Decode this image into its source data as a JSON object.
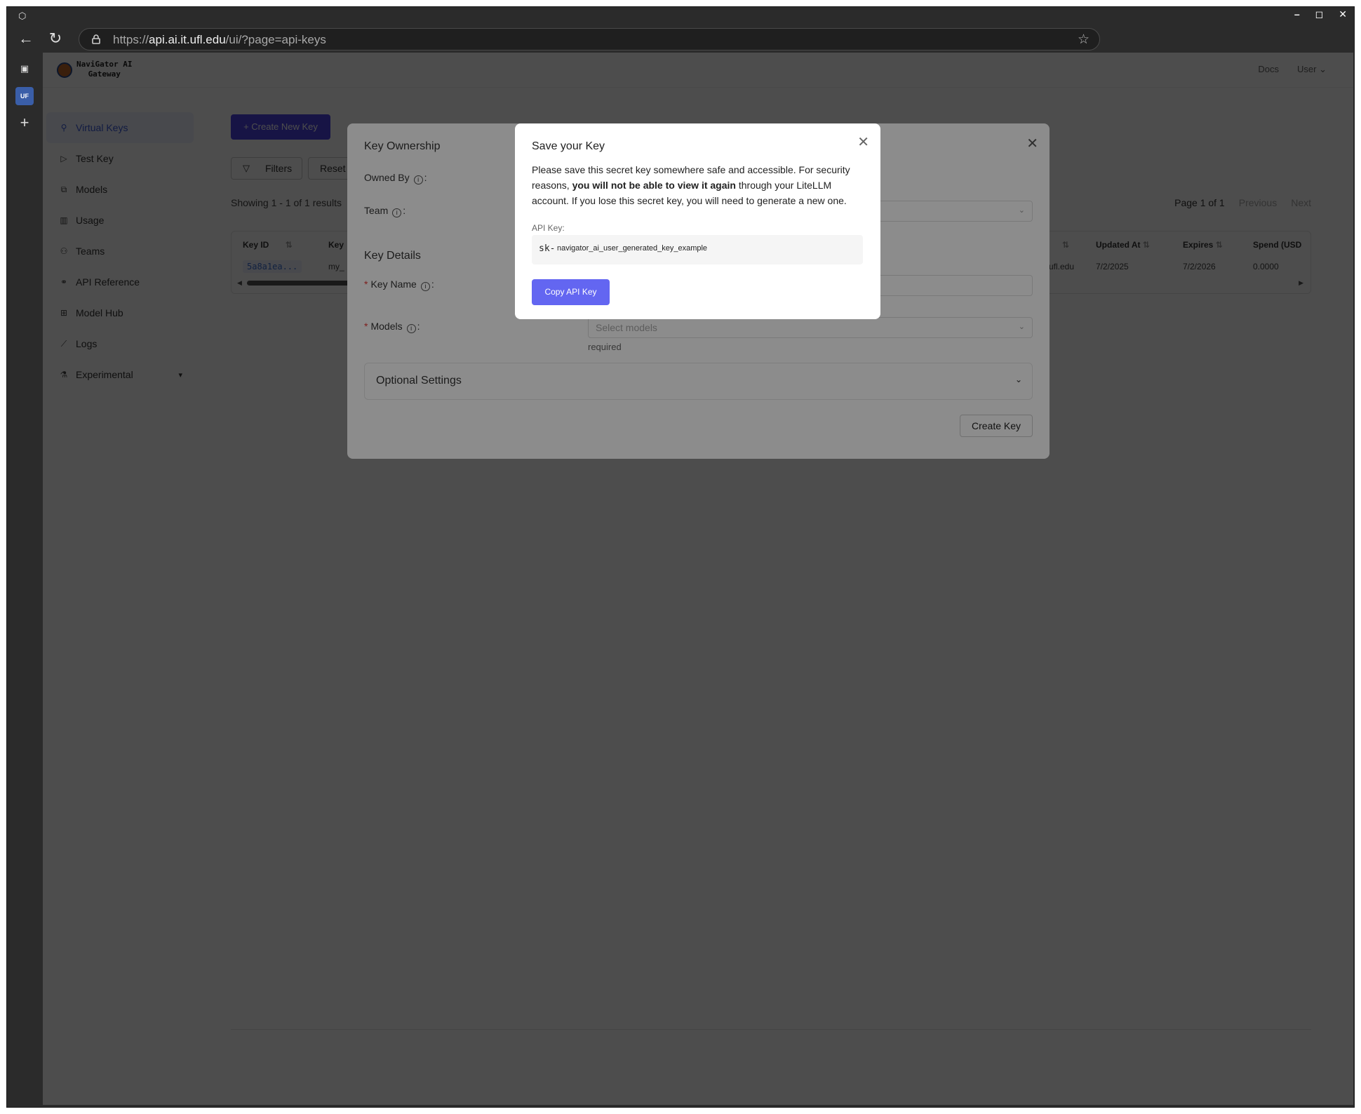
{
  "browser": {
    "url_scheme": "https://",
    "url_host": "api.ai.it.ufl.edu",
    "url_path": "/ui/?page=api-keys",
    "tab_favicon_text": "UF"
  },
  "app": {
    "brand_line1": "NaviGator AI",
    "brand_line2": "Gateway",
    "top_docs": "Docs",
    "top_user": "User"
  },
  "sidebar": {
    "items": [
      {
        "label": "Virtual Keys",
        "icon": "key-icon"
      },
      {
        "label": "Test Key",
        "icon": "play-circle-icon"
      },
      {
        "label": "Models",
        "icon": "blocks-icon"
      },
      {
        "label": "Usage",
        "icon": "bar-chart-icon"
      },
      {
        "label": "Teams",
        "icon": "team-icon"
      },
      {
        "label": "API Reference",
        "icon": "api-icon"
      },
      {
        "label": "Model Hub",
        "icon": "grid-icon"
      },
      {
        "label": "Logs",
        "icon": "line-chart-icon"
      },
      {
        "label": "Experimental",
        "icon": "flask-icon"
      }
    ]
  },
  "main": {
    "create_button": "+ Create New Key",
    "filters_button": "Filters",
    "reset_button": "Reset",
    "showing": "Showing 1 - 1 of 1 results",
    "page": "Page 1 of 1",
    "previous": "Previous",
    "next": "Next",
    "columns": [
      "Key ID",
      "Key",
      "Updated At",
      "Expires",
      "Spend (USD"
    ],
    "row": {
      "key_id": "5a8a1ea...",
      "key_alias": "my_",
      "email_tail": "ufl.edu",
      "updated_at": "7/2/2025",
      "expires": "7/2/2026",
      "spend": "0.0000"
    }
  },
  "create_modal": {
    "ownership_title": "Key Ownership",
    "owned_by": "Owned By",
    "team": "Team",
    "details_title": "Key Details",
    "key_name": "Key Name",
    "models": "Models",
    "models_placeholder": "Select models",
    "required_text": "required",
    "optional_settings": "Optional Settings",
    "create_key": "Create Key",
    "colon": ":"
  },
  "save_modal": {
    "title": "Save your Key",
    "text_part1": "Please save this secret key somewhere safe and accessible. For security reasons, ",
    "text_bold": "you will not be able to view it again",
    "text_part2": " through your LiteLLM account. If you lose this secret key, you will need to generate a new one.",
    "api_key_label": "API Key:",
    "key_prefix": "sk-",
    "key_value": "navigator_ai_user_generated_key_example",
    "copy_button": "Copy API Key"
  },
  "colors": {
    "primary": "#4f46e5",
    "copy_button": "#6366f1",
    "mask": "rgba(0,0,0,0.45)"
  }
}
